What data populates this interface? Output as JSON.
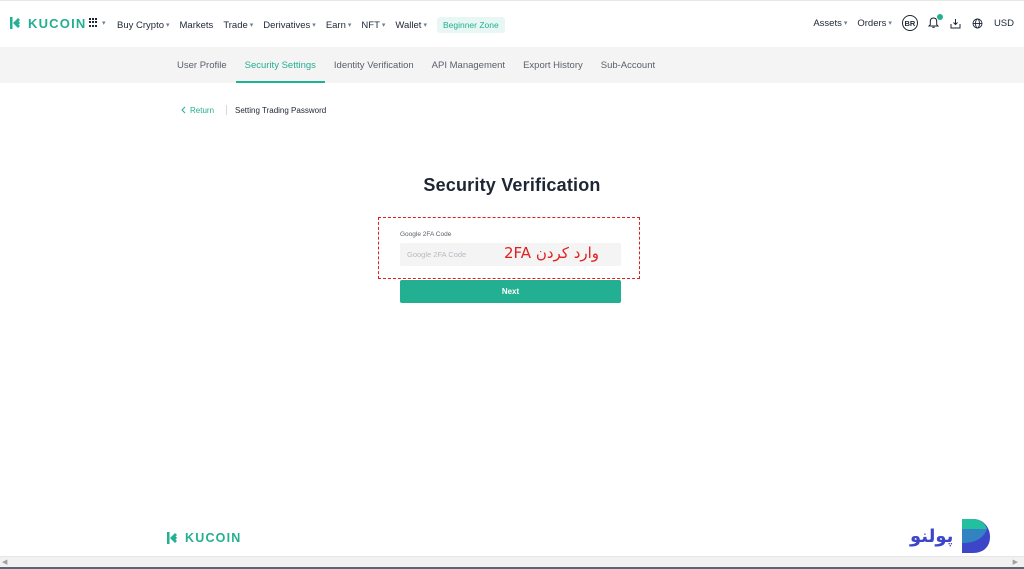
{
  "header": {
    "brand": "KUCOIN",
    "nav": [
      {
        "label": "Buy Crypto",
        "dropdown": true
      },
      {
        "label": "Markets",
        "dropdown": false
      },
      {
        "label": "Trade",
        "dropdown": true
      },
      {
        "label": "Derivatives",
        "dropdown": true
      },
      {
        "label": "Earn",
        "dropdown": true
      },
      {
        "label": "NFT",
        "dropdown": true
      },
      {
        "label": "Wallet",
        "dropdown": true
      }
    ],
    "beginner_zone": "Beginner Zone",
    "right": {
      "assets": "Assets",
      "orders": "Orders",
      "avatar_initials": "BR",
      "notification_count": "1",
      "currency": "USD"
    },
    "caret": "▾"
  },
  "subnav": {
    "tabs": [
      {
        "label": "User Profile",
        "active": false
      },
      {
        "label": "Security Settings",
        "active": true
      },
      {
        "label": "Identity Verification",
        "active": false
      },
      {
        "label": "API Management",
        "active": false
      },
      {
        "label": "Export History",
        "active": false
      },
      {
        "label": "Sub-Account",
        "active": false
      }
    ]
  },
  "breadcrumb": {
    "return_label": "Return",
    "current": "Setting Trading Password"
  },
  "main": {
    "title": "Security Verification",
    "field_label": "Google 2FA Code",
    "field_placeholder": "Google 2FA Code",
    "field_value": "",
    "annotation": "وارد کردن 2FA",
    "next_label": "Next"
  },
  "footer": {
    "brand": "KUCOIN"
  },
  "watermark": {
    "text": "پولنو"
  },
  "colors": {
    "accent": "#23af91",
    "annotation": "#e02020",
    "watermark": "#3d46c8"
  }
}
